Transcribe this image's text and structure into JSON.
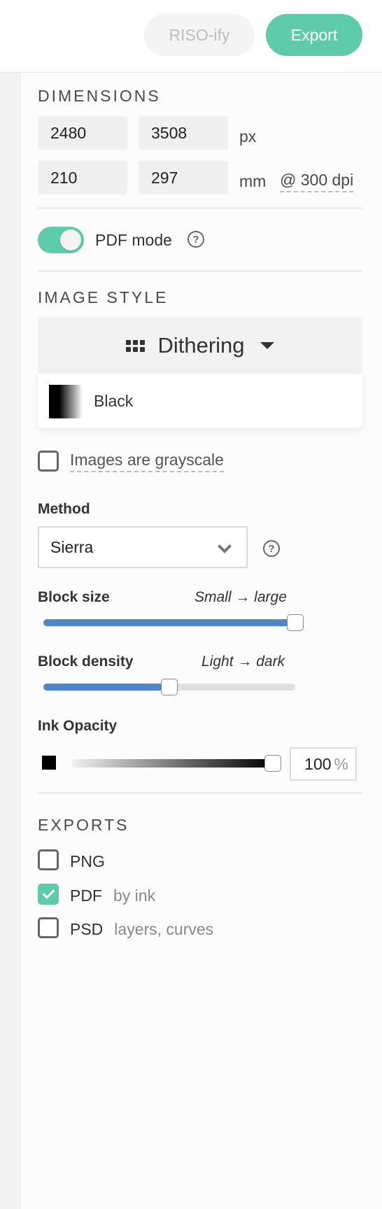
{
  "topbar": {
    "riso_label": "RISO-ify",
    "export_label": "Export"
  },
  "dimensions": {
    "heading": "DIMENSIONS",
    "width_px": "2480",
    "height_px": "3508",
    "px_unit": "px",
    "width_mm": "210",
    "height_mm": "297",
    "mm_unit": "mm",
    "dpi_label": "@ 300 dpi"
  },
  "pdf_mode": {
    "label": "PDF mode",
    "enabled": true,
    "help_icon": "question-circle-icon"
  },
  "image_style": {
    "heading": "IMAGE STYLE",
    "selected": "Dithering",
    "icon": "grid-icon",
    "ink": "Black",
    "grayscale_label": "Images are grayscale",
    "grayscale_checked": false
  },
  "method": {
    "label": "Method",
    "value": "Sierra",
    "help_icon": "question-circle-icon"
  },
  "block_size": {
    "label": "Block size",
    "hint": "Small → large",
    "value": 1.0
  },
  "block_density": {
    "label": "Block density",
    "hint": "Light → dark",
    "value": 0.5
  },
  "ink_opacity": {
    "label": "Ink Opacity",
    "value": "100",
    "unit": "%",
    "fraction": 1.0
  },
  "exports": {
    "heading": "EXPORTS",
    "items": [
      {
        "label": "PNG",
        "hint": "",
        "checked": false
      },
      {
        "label": "PDF",
        "hint": "by ink",
        "checked": true
      },
      {
        "label": "PSD",
        "hint": "layers, curves",
        "checked": false
      }
    ]
  },
  "colors": {
    "accent": "#5ecbaa",
    "slider": "#4f86c6"
  }
}
